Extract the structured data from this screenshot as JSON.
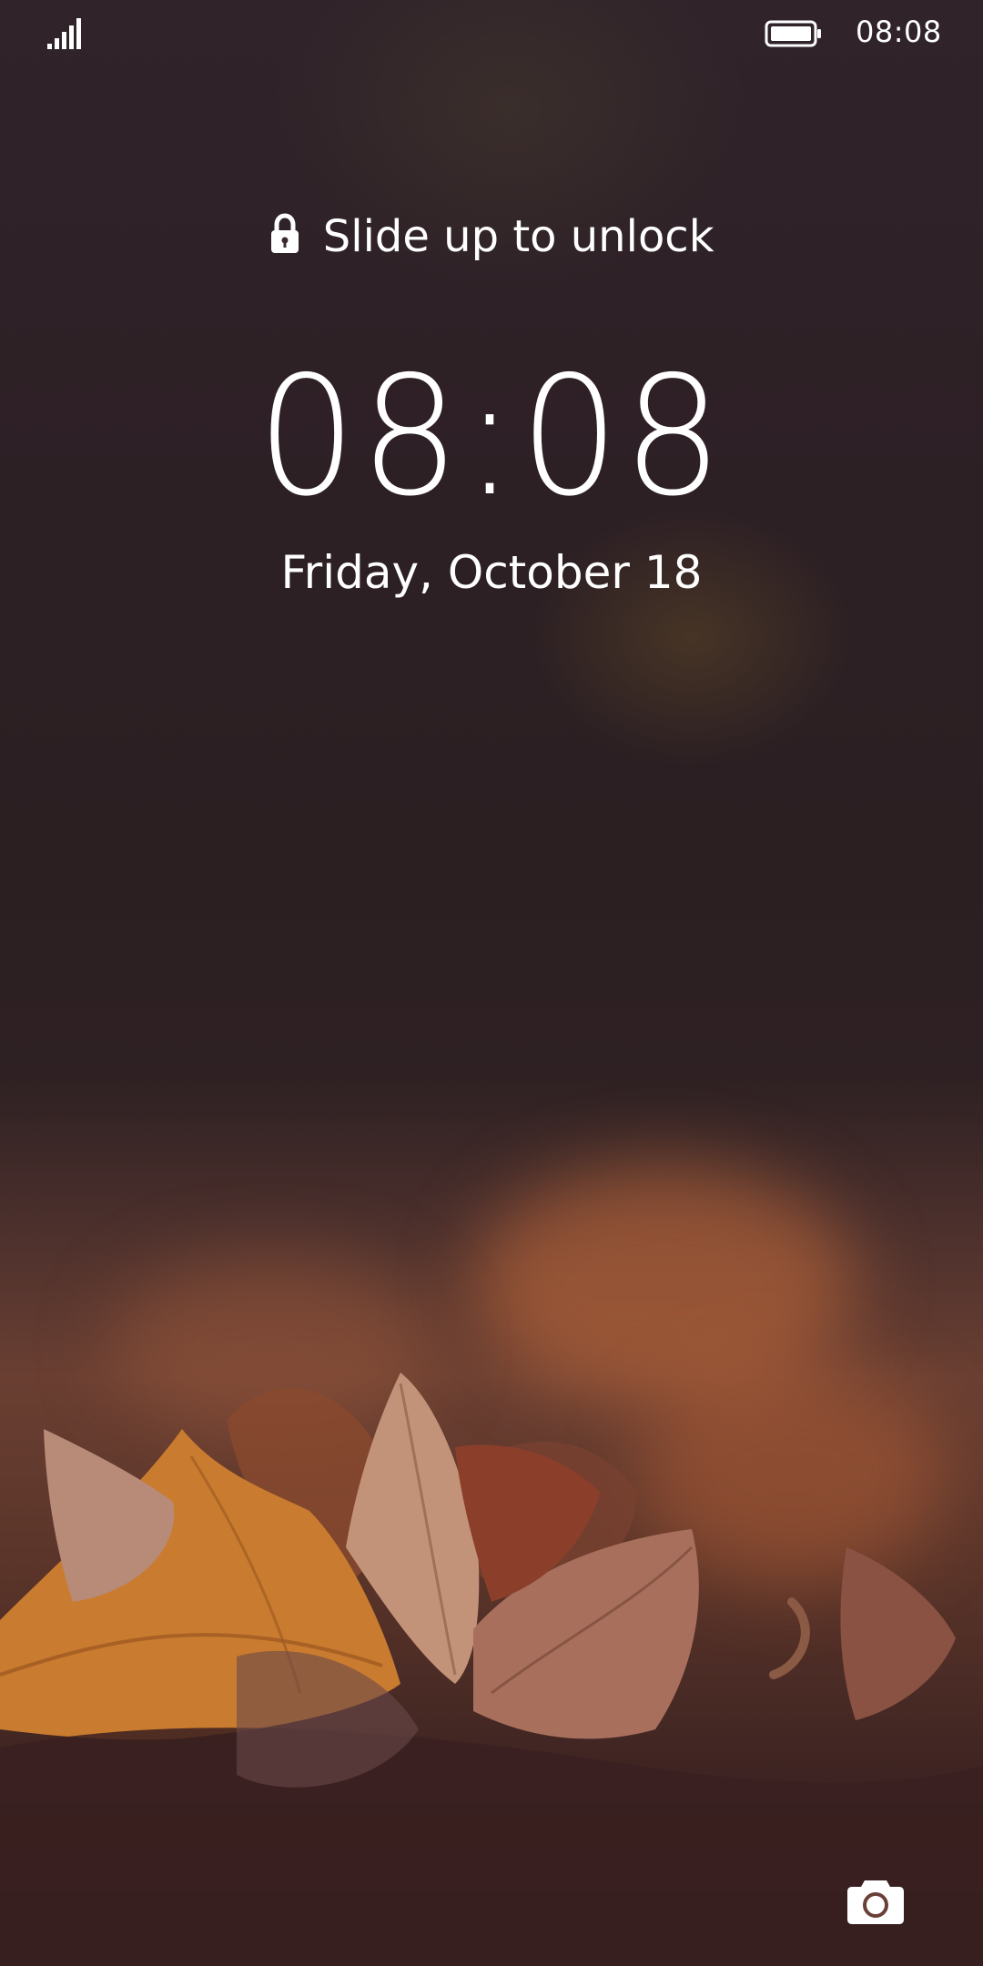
{
  "status_bar": {
    "signal_icon": "signal-strength-icon",
    "battery_icon": "battery-full-icon",
    "time": "08:08"
  },
  "lock_screen": {
    "hint_icon": "lock-icon",
    "hint_text": "Slide up to unlock",
    "clock": "08:08",
    "date": "Friday, October 18",
    "camera_icon": "camera-icon"
  },
  "colors": {
    "text": "#ffffff",
    "wallpaper_top": "#2d2025",
    "wallpaper_leaf": "#c8782e"
  }
}
